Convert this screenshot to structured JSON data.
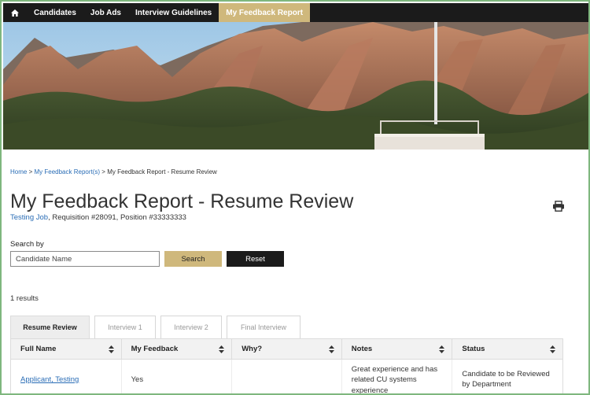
{
  "nav": {
    "home_icon": "home-icon",
    "items": [
      "Candidates",
      "Job Ads",
      "Interview Guidelines",
      "My Feedback Report"
    ],
    "active_index": 3
  },
  "breadcrumb": {
    "home": "Home",
    "sep1": " > ",
    "reports": "My Feedback Report(s)",
    "sep2": " > ",
    "current": "My Feedback Report - Resume Review"
  },
  "page": {
    "title": "My Feedback Report - Resume Review",
    "job_link": "Testing Job",
    "job_details": ", Requisition #28091, Position #33333333",
    "print_icon": "print-icon"
  },
  "search": {
    "label": "Search by",
    "placeholder": "Candidate Name",
    "search_label": "Search",
    "reset_label": "Reset"
  },
  "results_text": "1 results",
  "tabs": [
    {
      "label": "Resume Review"
    },
    {
      "label": "Interview 1"
    },
    {
      "label": "Interview 2"
    },
    {
      "label": "Final Interview"
    }
  ],
  "table": {
    "columns": [
      "Full Name",
      "My Feedback",
      "Why?",
      "Notes",
      "Status"
    ],
    "rows": [
      {
        "full_name": "Applicant, Testing",
        "feedback": "Yes",
        "why": "",
        "notes": "Great experience and has related CU systems experience",
        "status": "Candidate to be Reviewed by Department"
      }
    ]
  },
  "colors": {
    "nav_bg": "#1b1b1b",
    "accent_gold": "#cfb87c",
    "link": "#2a6db6",
    "frame": "#7fb77e"
  }
}
